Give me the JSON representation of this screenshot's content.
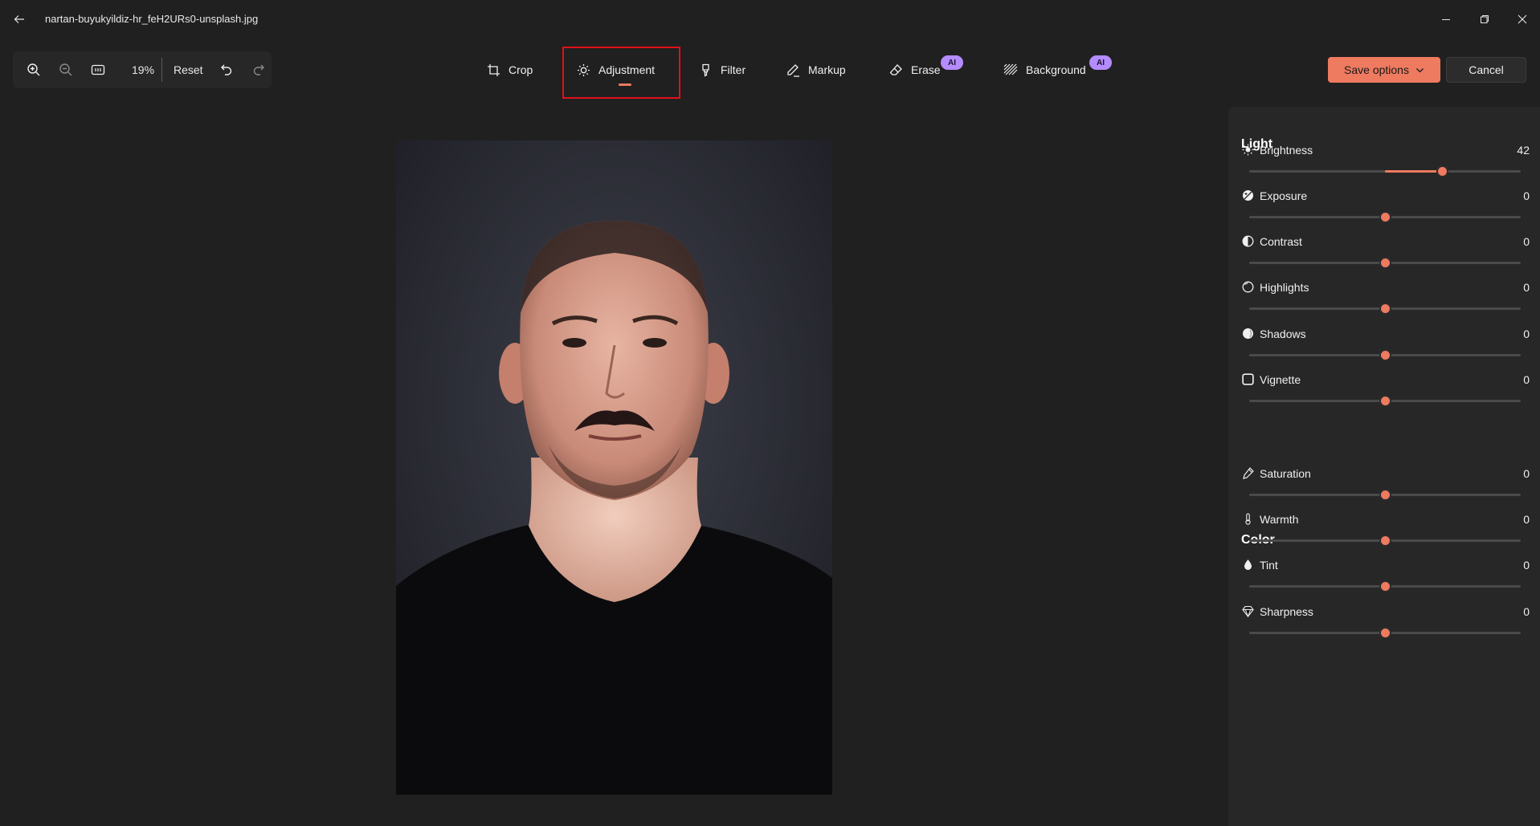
{
  "window": {
    "filename": "nartan-buyukyildiz-hr_feH2URs0-unsplash.jpg"
  },
  "zoom": {
    "level": "19%",
    "reset_label": "Reset"
  },
  "tools": {
    "crop": "Crop",
    "adjustment": "Adjustment",
    "filter": "Filter",
    "markup": "Markup",
    "erase": "Erase",
    "background": "Background",
    "ai_badge": "AI"
  },
  "actions": {
    "save": "Save options",
    "cancel": "Cancel"
  },
  "colors": {
    "accent": "#ee7a60",
    "highlight_frame": "#e0101a",
    "ai_badge": "#b58cff"
  },
  "panel": {
    "light": {
      "title": "Light",
      "items": [
        {
          "label": "Brightness",
          "value": "42",
          "icon": "brightness-icon",
          "range": [
            -100,
            100
          ]
        },
        {
          "label": "Exposure",
          "value": "0",
          "icon": "exposure-icon",
          "range": [
            -100,
            100
          ]
        },
        {
          "label": "Contrast",
          "value": "0",
          "icon": "contrast-icon",
          "range": [
            -100,
            100
          ]
        },
        {
          "label": "Highlights",
          "value": "0",
          "icon": "highlights-icon",
          "range": [
            -100,
            100
          ]
        },
        {
          "label": "Shadows",
          "value": "0",
          "icon": "shadows-icon",
          "range": [
            -100,
            100
          ]
        },
        {
          "label": "Vignette",
          "value": "0",
          "icon": "vignette-icon",
          "range": [
            -100,
            100
          ]
        }
      ]
    },
    "color": {
      "title": "Color",
      "items": [
        {
          "label": "Saturation",
          "value": "0",
          "icon": "saturation-icon",
          "range": [
            -100,
            100
          ]
        },
        {
          "label": "Warmth",
          "value": "0",
          "icon": "warmth-icon",
          "range": [
            -100,
            100
          ]
        },
        {
          "label": "Tint",
          "value": "0",
          "icon": "tint-icon",
          "range": [
            -100,
            100
          ]
        },
        {
          "label": "Sharpness",
          "value": "0",
          "icon": "sharpness-icon",
          "range": [
            -100,
            100
          ]
        }
      ]
    }
  }
}
